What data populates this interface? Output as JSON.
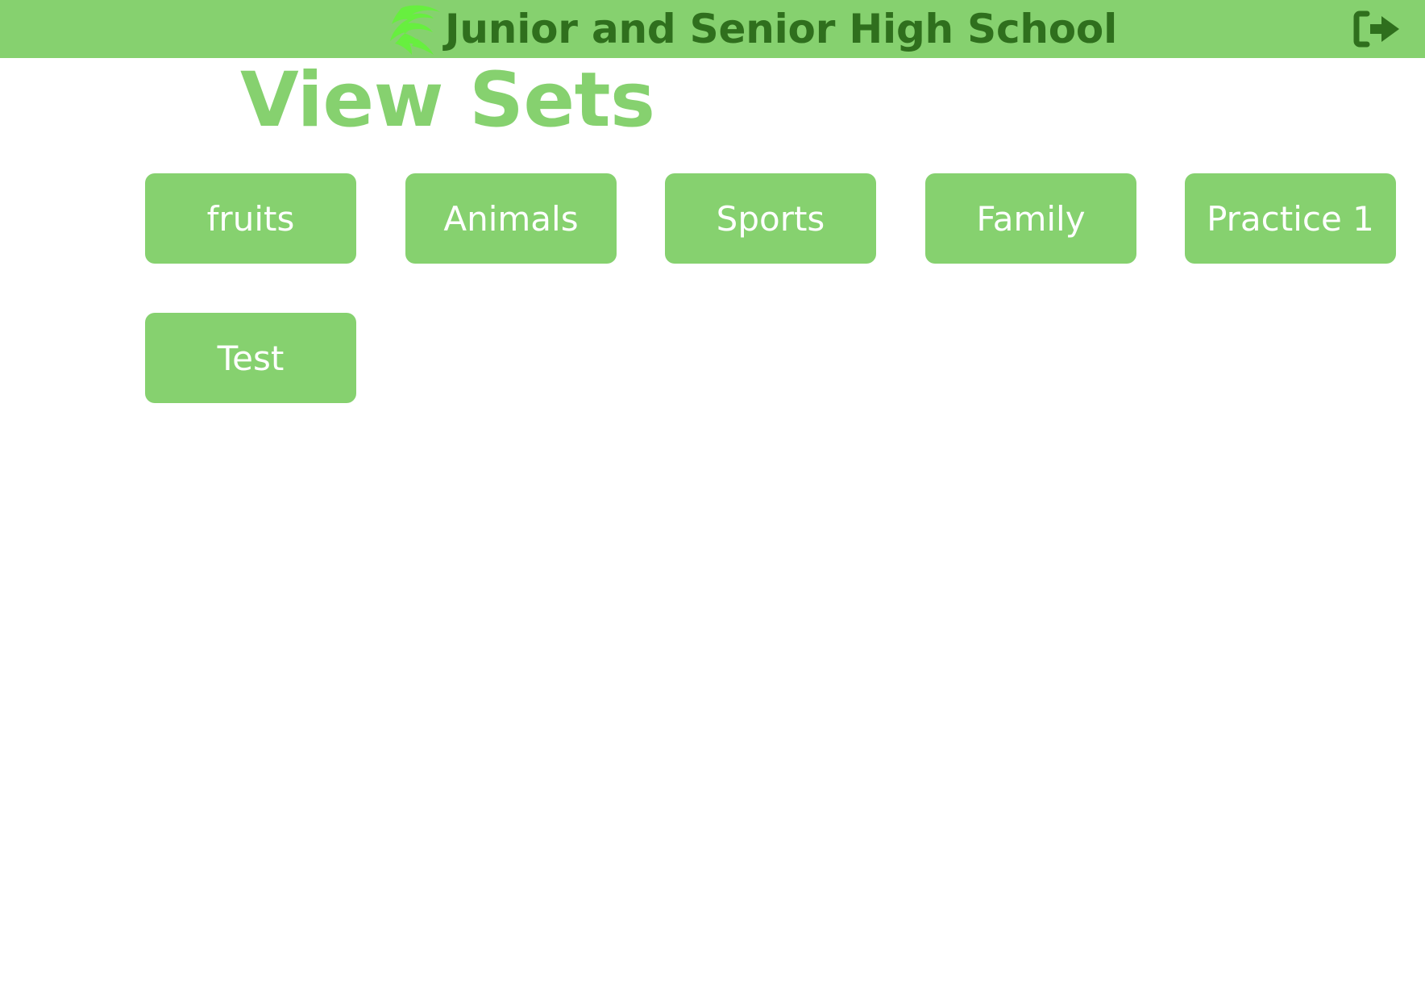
{
  "header": {
    "title": "Junior and Senior High School",
    "logo_icon": "swoosh-leaf-logo",
    "logout_icon": "sign-out-icon",
    "colors": {
      "header_bg": "#86d16f",
      "header_text": "#2f6f1d",
      "logo": "#67ef3f",
      "logout_icon": "#2f6f1d"
    }
  },
  "page": {
    "title": "View Sets",
    "title_color": "#86d16f"
  },
  "sets": [
    {
      "label": "fruits"
    },
    {
      "label": "Animals"
    },
    {
      "label": "Sports"
    },
    {
      "label": "Family"
    },
    {
      "label": "Practice 1"
    },
    {
      "label": "Test"
    }
  ],
  "card_colors": {
    "background": "#86d16f",
    "text": "#ffffff"
  }
}
